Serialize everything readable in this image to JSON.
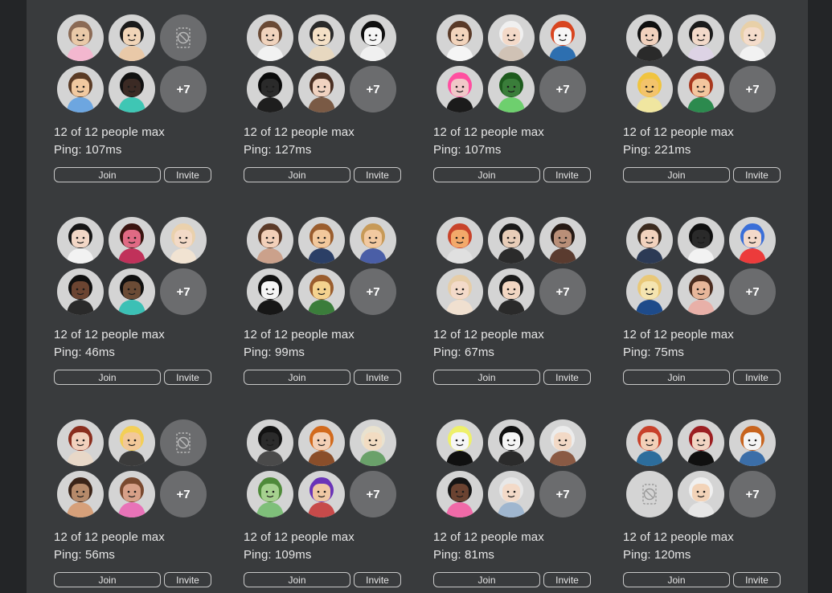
{
  "labels": {
    "more": "+7",
    "join": "Join",
    "invite": "Invite"
  },
  "colors": {
    "panel": "#393b3d",
    "background": "#232527",
    "avatar_bg": "#d4d4d4",
    "placeholder_bg": "#6b6c6e"
  },
  "servers": [
    {
      "capacity": "12 of 12 people max",
      "ping": "Ping: 107ms",
      "avatars": [
        {
          "kind": "player",
          "skin": "#e9c9a8",
          "hair": "#8b6a55",
          "shirt": "#f3b7cf"
        },
        {
          "kind": "player",
          "skin": "#f1d5b8",
          "hair": "#1b1b1b",
          "shirt": "#e9c9a8"
        },
        {
          "kind": "blocked"
        },
        {
          "kind": "player",
          "skin": "#f1c9a0",
          "hair": "#5a3b25",
          "shirt": "#6da6e0"
        },
        {
          "kind": "player",
          "skin": "#3b2a24",
          "hair": "#111111",
          "shirt": "#3fc6b4"
        }
      ]
    },
    {
      "capacity": "12 of 12 people max",
      "ping": "Ping: 127ms",
      "avatars": [
        {
          "kind": "player",
          "skin": "#f0d3bd",
          "hair": "#6a4a35",
          "shirt": "#f2f2f2"
        },
        {
          "kind": "player",
          "skin": "#f4e0c6",
          "hair": "#2a2a2a",
          "shirt": "#e7d8c0"
        },
        {
          "kind": "player",
          "skin": "#f5f5f5",
          "hair": "#0f0f0f",
          "shirt": "#f0f0f0"
        },
        {
          "kind": "player",
          "skin": "#2a2a2a",
          "hair": "#0b0b0b",
          "shirt": "#1e1e1e"
        },
        {
          "kind": "player",
          "skin": "#f0d2c0",
          "hair": "#4a2f22",
          "shirt": "#7a5a45"
        }
      ]
    },
    {
      "capacity": "12 of 12 people max",
      "ping": "Ping: 107ms",
      "avatars": [
        {
          "kind": "player",
          "skin": "#f2d4bc",
          "hair": "#5a3a28",
          "shirt": "#f5f5f5"
        },
        {
          "kind": "player",
          "skin": "#f3d9c8",
          "hair": "#f0f0f0",
          "shirt": "#d0c2b5"
        },
        {
          "kind": "player",
          "skin": "#f6f6f6",
          "hair": "#d8451f",
          "shirt": "#2d6fb0"
        },
        {
          "kind": "player",
          "skin": "#f0c8c8",
          "hair": "#ff4fa0",
          "shirt": "#1b1b1b"
        },
        {
          "kind": "player",
          "skin": "#3a7d3a",
          "hair": "#1d5a1d",
          "shirt": "#6ecf6e"
        }
      ]
    },
    {
      "capacity": "12 of 12 people max",
      "ping": "Ping: 221ms",
      "avatars": [
        {
          "kind": "player",
          "skin": "#f1d1bd",
          "hair": "#101010",
          "shirt": "#2a2a2a"
        },
        {
          "kind": "player",
          "skin": "#f2d9c9",
          "hair": "#1b1b1b",
          "shirt": "#ddd3e5"
        },
        {
          "kind": "player",
          "skin": "#f4dccb",
          "hair": "#e8d0a8",
          "shirt": "#f2f2f2"
        },
        {
          "kind": "player",
          "skin": "#f3c36b",
          "hair": "#f0c440",
          "shirt": "#f0e6a0"
        },
        {
          "kind": "player",
          "skin": "#f3c69e",
          "hair": "#a8381e",
          "shirt": "#2c8a4e"
        }
      ]
    },
    {
      "capacity": "12 of 12 people max",
      "ping": "Ping: 46ms",
      "avatars": [
        {
          "kind": "player",
          "skin": "#f3d7c6",
          "hair": "#161616",
          "shirt": "#f2f2f2"
        },
        {
          "kind": "player",
          "skin": "#e06a84",
          "hair": "#3a1410",
          "shirt": "#c0315a"
        },
        {
          "kind": "player",
          "skin": "#f3dac7",
          "hair": "#ead1ad",
          "shirt": "#f1e3d2"
        },
        {
          "kind": "player",
          "skin": "#6b4431",
          "hair": "#101010",
          "shirt": "#2a2a2a"
        },
        {
          "kind": "player",
          "skin": "#6b4b35",
          "hair": "#101010",
          "shirt": "#3cc0b5"
        }
      ]
    },
    {
      "capacity": "12 of 12 people max",
      "ping": "Ping: 99ms",
      "avatars": [
        {
          "kind": "player",
          "skin": "#f2d0b9",
          "hair": "#5b3a28",
          "shirt": "#cba18b"
        },
        {
          "kind": "player",
          "skin": "#f2c89c",
          "hair": "#9a5d2e",
          "shirt": "#2b3f66"
        },
        {
          "kind": "player",
          "skin": "#f2c9a0",
          "hair": "#c79a58",
          "shirt": "#4a5ea6"
        },
        {
          "kind": "player",
          "skin": "#f5f5f5",
          "hair": "#111111",
          "shirt": "#171717"
        },
        {
          "kind": "player",
          "skin": "#f4d28f",
          "hair": "#9a5d2e",
          "shirt": "#3b7d3b"
        }
      ]
    },
    {
      "capacity": "12 of 12 people max",
      "ping": "Ping: 67ms",
      "avatars": [
        {
          "kind": "player",
          "skin": "#f3a96a",
          "hair": "#c8432a",
          "shirt": "#e0e0e0"
        },
        {
          "kind": "player",
          "skin": "#e8cdb8",
          "hair": "#1a1a1a",
          "shirt": "#2b2b2b"
        },
        {
          "kind": "player",
          "skin": "#b98f78",
          "hair": "#261a14",
          "shirt": "#5a3b2f"
        },
        {
          "kind": "player",
          "skin": "#f3dac9",
          "hair": "#e6cda8",
          "shirt": "#f0e0d0"
        },
        {
          "kind": "player",
          "skin": "#f2d6c2",
          "hair": "#1a1a1a",
          "shirt": "#2a2a2a"
        }
      ]
    },
    {
      "capacity": "12 of 12 people max",
      "ping": "Ping: 75ms",
      "avatars": [
        {
          "kind": "player",
          "skin": "#f2d2bd",
          "hair": "#3b2b20",
          "shirt": "#2c3a55"
        },
        {
          "kind": "player",
          "skin": "#2a2a2a",
          "hair": "#101010",
          "shirt": "#f2f2f2"
        },
        {
          "kind": "player",
          "skin": "#f3d9c9",
          "hair": "#3a6fd8",
          "shirt": "#ec3b3b"
        },
        {
          "kind": "player",
          "skin": "#f4e4b0",
          "hair": "#e9c878",
          "shirt": "#1e4b8a"
        },
        {
          "kind": "player",
          "skin": "#e7b69a",
          "hair": "#4a2c1f",
          "shirt": "#e8b0a8"
        }
      ]
    },
    {
      "capacity": "12 of 12 people max",
      "ping": "Ping: 56ms",
      "avatars": [
        {
          "kind": "player",
          "skin": "#f2d1bd",
          "hair": "#8a2e1e",
          "shirt": "#e8d8c8"
        },
        {
          "kind": "player",
          "skin": "#f2c899",
          "hair": "#f3cf57",
          "shirt": "#3b3b3b"
        },
        {
          "kind": "blocked"
        },
        {
          "kind": "player",
          "skin": "#b68a6a",
          "hair": "#3b2418",
          "shirt": "#d6a07a"
        },
        {
          "kind": "player",
          "skin": "#d7a088",
          "hair": "#7a4a30",
          "shirt": "#e873b8"
        }
      ]
    },
    {
      "capacity": "12 of 12 people max",
      "ping": "Ping: 109ms",
      "avatars": [
        {
          "kind": "player",
          "skin": "#2b2b2b",
          "hair": "#121212",
          "shirt": "#4a4a4a"
        },
        {
          "kind": "player",
          "skin": "#f3d0b6",
          "hair": "#d26a1d",
          "shirt": "#8a4e2a"
        },
        {
          "kind": "player",
          "skin": "#f2dcc2",
          "hair": "#e9e2cf",
          "shirt": "#6aa16a"
        },
        {
          "kind": "player",
          "skin": "#a6d18f",
          "hair": "#4f8a3a",
          "shirt": "#7fbf7a"
        },
        {
          "kind": "player",
          "skin": "#f0c8a4",
          "hair": "#6a34b8",
          "shirt": "#c74a4a"
        }
      ]
    },
    {
      "capacity": "12 of 12 people max",
      "ping": "Ping: 81ms",
      "avatars": [
        {
          "kind": "player",
          "skin": "#f6f6f6",
          "hair": "#eef06a",
          "shirt": "#101010"
        },
        {
          "kind": "player",
          "skin": "#f5f5f5",
          "hair": "#111111",
          "shirt": "#2b2b2b"
        },
        {
          "kind": "player",
          "skin": "#f2d9c6",
          "hair": "#ececec",
          "shirt": "#8a5a44"
        },
        {
          "kind": "player",
          "skin": "#6b4331",
          "hair": "#151515",
          "shirt": "#f06aa8"
        },
        {
          "kind": "player",
          "skin": "#f3dac8",
          "hair": "#e8e8e8",
          "shirt": "#9fb6cf"
        }
      ]
    },
    {
      "capacity": "12 of 12 people max",
      "ping": "Ping: 120ms",
      "avatars": [
        {
          "kind": "player",
          "skin": "#f2d0b8",
          "hair": "#c8412a",
          "shirt": "#2c6d9c"
        },
        {
          "kind": "player",
          "skin": "#f1d4c2",
          "hair": "#9c1f22",
          "shirt": "#101010"
        },
        {
          "kind": "player",
          "skin": "#f4f4f4",
          "hair": "#c8641e",
          "shirt": "#3b6ea8"
        },
        {
          "kind": "blocked_light"
        },
        {
          "kind": "player",
          "skin": "#f2d3b8",
          "hair": "#f0f0f0",
          "shirt": "#e6e6e6"
        }
      ]
    }
  ]
}
